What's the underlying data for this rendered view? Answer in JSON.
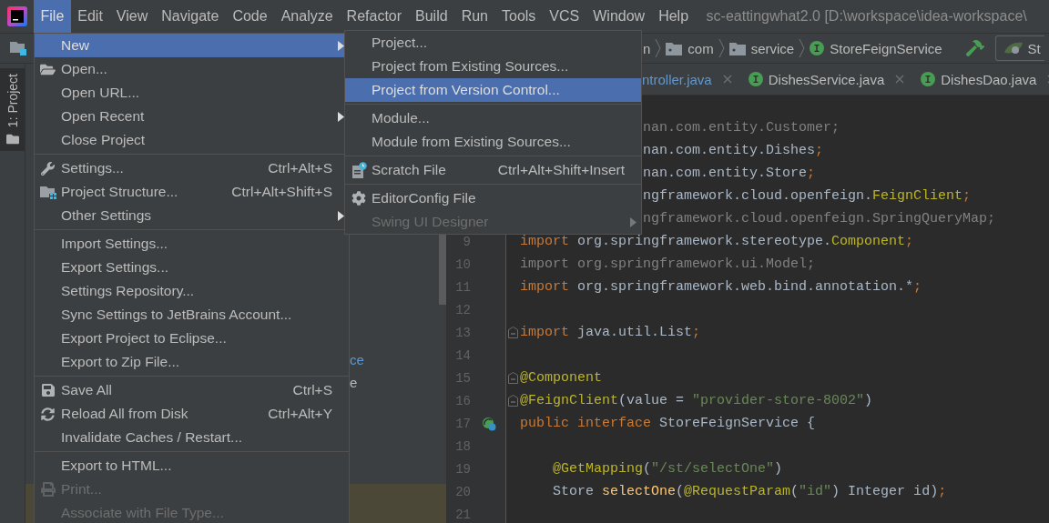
{
  "menu_bar": {
    "items": [
      {
        "label": "File",
        "selected": true
      },
      {
        "label": "Edit",
        "selected": false
      },
      {
        "label": "View",
        "selected": false
      },
      {
        "label": "Navigate",
        "selected": false
      },
      {
        "label": "Code",
        "selected": false
      },
      {
        "label": "Analyze",
        "selected": false
      },
      {
        "label": "Refactor",
        "selected": false
      },
      {
        "label": "Build",
        "selected": false
      },
      {
        "label": "Run",
        "selected": false
      },
      {
        "label": "Tools",
        "selected": false
      },
      {
        "label": "VCS",
        "selected": false
      },
      {
        "label": "Window",
        "selected": false
      },
      {
        "label": "Help",
        "selected": false
      }
    ],
    "title": "sc-eattingwhat2.0 [D:\\workspace\\idea-workspace\\"
  },
  "navigation_bar": {
    "breadcrumbs": [
      {
        "label": "n",
        "kind": "plain"
      },
      {
        "label": "com",
        "kind": "package"
      },
      {
        "label": "service",
        "kind": "package"
      },
      {
        "label": "StoreFeignService",
        "kind": "interface"
      }
    ],
    "run_configuration": "St"
  },
  "tool_windows": [
    {
      "label": "1: Project",
      "selected": true
    }
  ],
  "project_tree": [
    {
      "label": "ce",
      "color": "#5f97cf"
    },
    {
      "label": "e",
      "color": "#bbbbbb"
    }
  ],
  "editor_tabs": [
    {
      "label": "ntroller.java",
      "kind": "cut",
      "color": "#5f97cf"
    },
    {
      "label": "DishesService.java",
      "kind": "interface",
      "color": "#bbbbbb"
    },
    {
      "label": "DishesDao.java",
      "kind": "interface",
      "color": "#bbbbbb"
    }
  ],
  "code_lines": [
    {
      "tokens": [
        {
          "text": "nan.com.entity.Customer;",
          "kind": "dim"
        }
      ]
    },
    {
      "tokens": [
        {
          "text": "nan.com.entity.Dishes",
          "kind": "id"
        },
        {
          "text": ";",
          "kind": "kw"
        }
      ]
    },
    {
      "tokens": [
        {
          "text": "nan.com.entity.Store",
          "kind": "id"
        },
        {
          "text": ";",
          "kind": "kw"
        }
      ]
    },
    {
      "tokens": [
        {
          "text": "ngframework.cloud.openfeign.",
          "kind": "id"
        },
        {
          "text": "FeignClient",
          "kind": "ann"
        },
        {
          "text": ";",
          "kind": "kw"
        }
      ]
    },
    {
      "tokens": [
        {
          "text": "ngframework.cloud.openfeign.SpringQueryMap;",
          "kind": "dim"
        }
      ]
    },
    {
      "number": "9",
      "tokens": [
        {
          "text": "import",
          "kind": "kw"
        },
        {
          "text": " org.springframework.stereotype.",
          "kind": "id"
        },
        {
          "text": "Component",
          "kind": "ann"
        },
        {
          "text": ";",
          "kind": "kw"
        }
      ]
    },
    {
      "number": "10",
      "tokens": [
        {
          "text": "import org.springframework.ui.Model;",
          "kind": "dim"
        }
      ]
    },
    {
      "number": "11",
      "tokens": [
        {
          "text": "import",
          "kind": "kw"
        },
        {
          "text": " org.springframework.web.bind.annotation.*",
          "kind": "id"
        },
        {
          "text": ";",
          "kind": "kw"
        }
      ]
    },
    {
      "number": "12"
    },
    {
      "number": "13",
      "kind": "fold",
      "tokens": [
        {
          "text": "import",
          "kind": "kw"
        },
        {
          "text": " java.util.List",
          "kind": "id"
        },
        {
          "text": ";",
          "kind": "kw"
        }
      ]
    },
    {
      "number": "14"
    },
    {
      "number": "15",
      "kind": "fold",
      "tokens": [
        {
          "text": "@Component",
          "kind": "ann"
        }
      ]
    },
    {
      "number": "16",
      "kind": "fold",
      "tokens": [
        {
          "text": "@FeignClient",
          "kind": "ann"
        },
        {
          "text": "(value = ",
          "kind": "id"
        },
        {
          "text": "\"provider-store-8002\"",
          "kind": "str"
        },
        {
          "text": ")",
          "kind": "id"
        }
      ]
    },
    {
      "number": "17",
      "kind": "implemented",
      "tokens": [
        {
          "text": "public",
          "kind": "kw"
        },
        {
          "text": " interface",
          "kind": "kw"
        },
        {
          "text": " StoreFeignService {",
          "kind": "id"
        }
      ]
    },
    {
      "number": "18"
    },
    {
      "number": "19",
      "tokens": [
        {
          "text": "    @GetMapping",
          "kind": "ann"
        },
        {
          "text": "(",
          "kind": "id"
        },
        {
          "text": "\"/st/selectOne\"",
          "kind": "str"
        },
        {
          "text": ")",
          "kind": "id"
        }
      ]
    },
    {
      "number": "20",
      "tokens": [
        {
          "text": "    Store ",
          "kind": "id"
        },
        {
          "text": "selectOne",
          "kind": "method"
        },
        {
          "text": "(",
          "kind": "id"
        },
        {
          "text": "@RequestParam",
          "kind": "ann"
        },
        {
          "text": "(",
          "kind": "id"
        },
        {
          "text": "\"id\"",
          "kind": "str"
        },
        {
          "text": ") Integer id)",
          "kind": "id"
        },
        {
          "text": ";",
          "kind": "kw"
        }
      ]
    },
    {
      "number": "21"
    }
  ],
  "file_menu": [
    {
      "kind": "item",
      "label": "New",
      "selected": true,
      "disabled": false,
      "submenu": true
    },
    {
      "kind": "item",
      "label": "Open...",
      "selected": false,
      "disabled": false,
      "submenu": false
    },
    {
      "kind": "item",
      "label": "Open URL...",
      "selected": false,
      "disabled": false,
      "submenu": false
    },
    {
      "kind": "item",
      "label": "Open Recent",
      "selected": false,
      "disabled": false,
      "submenu": true
    },
    {
      "kind": "item",
      "label": "Close Project",
      "selected": false,
      "disabled": false,
      "submenu": false
    },
    {
      "kind": "separator"
    },
    {
      "kind": "item",
      "label": "Settings...",
      "shortcut": "Ctrl+Alt+S",
      "selected": false,
      "disabled": false,
      "submenu": false
    },
    {
      "kind": "item",
      "label": "Project Structure...",
      "shortcut": "Ctrl+Alt+Shift+S",
      "selected": false,
      "disabled": false,
      "submenu": false
    },
    {
      "kind": "item",
      "label": "Other Settings",
      "selected": false,
      "disabled": false,
      "submenu": true
    },
    {
      "kind": "separator"
    },
    {
      "kind": "item",
      "label": "Import Settings...",
      "selected": false,
      "disabled": false,
      "submenu": false
    },
    {
      "kind": "item",
      "label": "Export Settings...",
      "selected": false,
      "disabled": false,
      "submenu": false
    },
    {
      "kind": "item",
      "label": "Settings Repository...",
      "selected": false,
      "disabled": false,
      "submenu": false
    },
    {
      "kind": "item",
      "label": "Sync Settings to JetBrains Account...",
      "selected": false,
      "disabled": false,
      "submenu": false
    },
    {
      "kind": "item",
      "label": "Export Project to Eclipse...",
      "selected": false,
      "disabled": false,
      "submenu": false
    },
    {
      "kind": "item",
      "label": "Export to Zip File...",
      "selected": false,
      "disabled": false,
      "submenu": false
    },
    {
      "kind": "separator"
    },
    {
      "kind": "item",
      "label": "Save All",
      "shortcut": "Ctrl+S",
      "selected": false,
      "disabled": false,
      "submenu": false
    },
    {
      "kind": "item",
      "label": "Reload All from Disk",
      "shortcut": "Ctrl+Alt+Y",
      "selected": false,
      "disabled": false,
      "submenu": false
    },
    {
      "kind": "item",
      "label": "Invalidate Caches / Restart...",
      "selected": false,
      "disabled": false,
      "submenu": false
    },
    {
      "kind": "separator"
    },
    {
      "kind": "item",
      "label": "Export to HTML...",
      "selected": false,
      "disabled": false,
      "submenu": false
    },
    {
      "kind": "item",
      "label": "Print...",
      "selected": false,
      "disabled": true,
      "submenu": false
    },
    {
      "kind": "item",
      "label": "Associate with File Type...",
      "selected": false,
      "disabled": true,
      "submenu": false
    }
  ],
  "new_submenu": [
    {
      "kind": "item",
      "label": "Project...",
      "selected": false,
      "disabled": false,
      "submenu": false
    },
    {
      "kind": "item",
      "label": "Project from Existing Sources...",
      "selected": false,
      "disabled": false,
      "submenu": false
    },
    {
      "kind": "item",
      "label": "Project from Version Control...",
      "selected": true,
      "disabled": false,
      "submenu": false
    },
    {
      "kind": "separator"
    },
    {
      "kind": "item",
      "label": "Module...",
      "selected": false,
      "disabled": false,
      "submenu": false
    },
    {
      "kind": "item",
      "label": "Module from Existing Sources...",
      "selected": false,
      "disabled": false,
      "submenu": false
    },
    {
      "kind": "separator"
    },
    {
      "kind": "item",
      "label": "Scratch File",
      "shortcut": "Ctrl+Alt+Shift+Insert",
      "selected": false,
      "disabled": false,
      "submenu": false
    },
    {
      "kind": "separator"
    },
    {
      "kind": "item",
      "label": "EditorConfig File",
      "selected": false,
      "disabled": false,
      "submenu": false
    },
    {
      "kind": "item",
      "label": "Swing UI Designer",
      "selected": false,
      "disabled": true,
      "submenu": true
    }
  ]
}
